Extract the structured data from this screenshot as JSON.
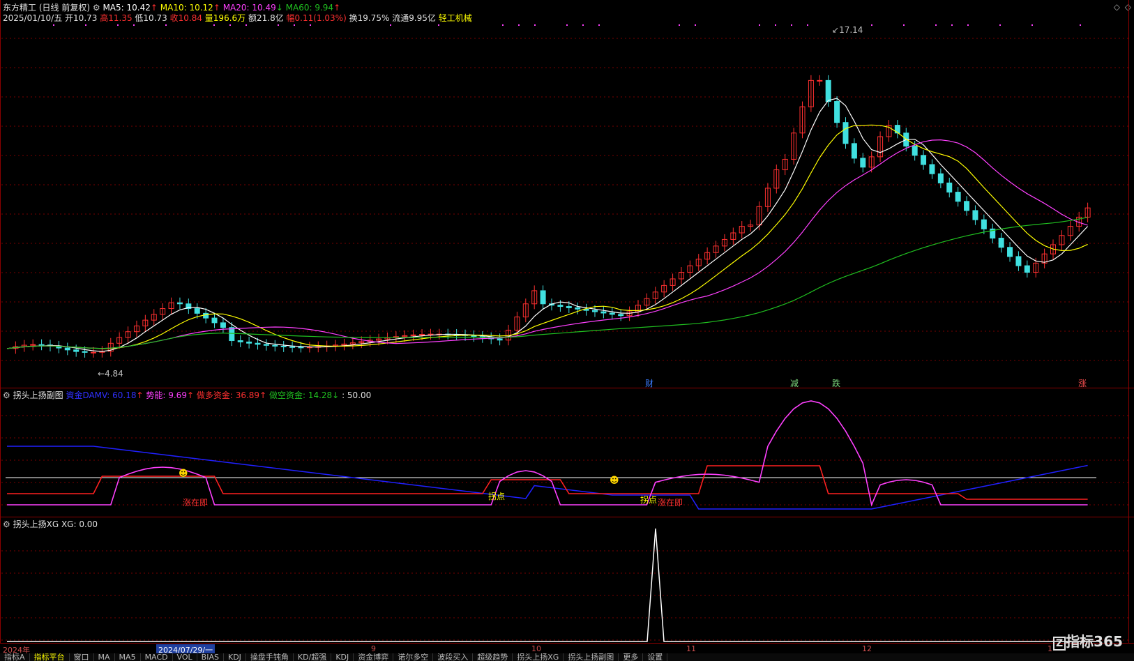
{
  "header": {
    "stock_name": "东方精工",
    "mode": "(日线 前复权)",
    "ma5": "MA5: 10.42",
    "ma10": "MA10: 10.12",
    "ma20": "MA20: 10.49",
    "ma60": "MA60: 9.94",
    "date": "2025/01/10/五",
    "open": "开10.73",
    "high": "高11.35",
    "low": "低10.73",
    "close": "收10.84",
    "volume": "量196.6万",
    "amount": "额21.8亿",
    "change": "幅0.11(1.03%)",
    "turnover": "换19.75%",
    "float": "流通9.95亿",
    "sector": "轻工机械"
  },
  "price_chart": {
    "high_label": "17.14",
    "low_label": "4.84",
    "event_marks": [
      {
        "text": "财",
        "color": "#3a7bff"
      },
      {
        "text": "减",
        "color": "#7fdc7f"
      },
      {
        "text": "跌",
        "color": "#7fdc7f"
      },
      {
        "text": "涨",
        "color": "#ff5050"
      }
    ],
    "colors": {
      "up": "#ff3030",
      "down": "#40e0e0",
      "ma5": "#ffffff",
      "ma10": "#ffff00",
      "ma20": "#ff40ff",
      "ma60": "#20c020"
    }
  },
  "sub1": {
    "title": "拐头上扬副图",
    "damv": "資金DAMV: 60.18",
    "momentum": "势能: 9.69",
    "long_fund": "做多资金: 36.89",
    "short_fund": "做空资金: 14.28",
    "level": ": 50.00",
    "labels": [
      "涨在即",
      "拐点",
      "拐点",
      "涨在即"
    ]
  },
  "sub2": {
    "title": "拐头上扬XG",
    "xg": "XG: 0.00"
  },
  "time_axis": {
    "labels": [
      "2024年",
      "2024/07/29/一",
      "9",
      "10",
      "11",
      "12",
      "1"
    ]
  },
  "tabs": [
    "指标A",
    "指标平台",
    "窗口",
    "MA",
    "MA5",
    "MACD",
    "VOL",
    "BIAS",
    "KDJ",
    "操盘手钝角",
    "KD/超强",
    "KDJ",
    "资金博弈",
    "诺尔多空",
    "波段买入",
    "超级趋势",
    "拐头上扬XG",
    "拐头上扬副图",
    "更多",
    "设置"
  ],
  "watermark": "指标365"
}
